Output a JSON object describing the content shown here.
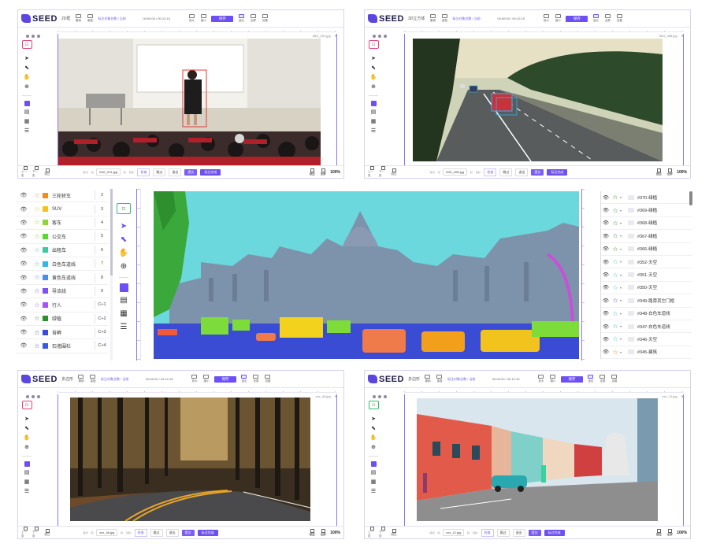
{
  "app": {
    "logo_text": "SEED",
    "win1_mode": "2D框",
    "win2_mode": "3D立方体",
    "win3_mode": "多边形",
    "win4_mode": "多边形",
    "undo": "撤销",
    "redo": "重做",
    "tb_a": "放大",
    "tb_b": "缩小",
    "tb_c": "适应",
    "tb_d": "全屏",
    "tb_e": "设置",
    "tb_f": "快捷",
    "tb_g": "选项",
    "save": "保存",
    "info_left": "标注对象总数 / 当前",
    "info_mid": "00:00:00 / 00:12:15",
    "info_right": "3/12  已标注图片数",
    "zoom": "100%",
    "prev": "上一张",
    "next": "下一张",
    "skip": "跳过",
    "submit": "提交",
    "exit": "退出",
    "check": "检查",
    "review": "审核通过",
    "quit": "标注完成",
    "file1": "IMG_001.jpg",
    "file2": "IMG_088.jpg",
    "file3": "xxx_46.jpg",
    "file4": "xxx_12.jpg"
  },
  "labels": [
    {
      "name": "三轮轿车",
      "key": "2",
      "color": "#f28c1c",
      "star": "#f28c1c"
    },
    {
      "name": "SUV",
      "key": "3",
      "color": "#f2c31c",
      "star": "#f2c31c"
    },
    {
      "name": "客车",
      "key": "4",
      "color": "#8fd43a",
      "star": "#8fd43a"
    },
    {
      "name": "公交车",
      "key": "5",
      "color": "#5fd43a",
      "star": "#5fd43a"
    },
    {
      "name": "出租车",
      "key": "6",
      "color": "#3ec8a0",
      "star": "#3ec8a0"
    },
    {
      "name": "白色车道线",
      "key": "7",
      "color": "#3ab4e0",
      "star": "#3ab4e0"
    },
    {
      "name": "黄色车道线",
      "key": "8",
      "color": "#4c8fea",
      "star": "#4c8fea"
    },
    {
      "name": "导流线",
      "key": "9",
      "color": "#7a54ef",
      "star": "#7a54ef"
    },
    {
      "name": "行人",
      "key": "C+1",
      "color": "#a854ef",
      "star": "#a854ef"
    },
    {
      "name": "绿植",
      "key": "C+2",
      "color": "#2e8f2e",
      "star": "#2e8f2e"
    },
    {
      "name": "苔藓",
      "key": "C+3",
      "color": "#3a4cd4",
      "star": "#3a4cd4"
    },
    {
      "name": "石墙围栏",
      "key": "C+4",
      "color": "#3a58e0",
      "star": "#3a58e0"
    }
  ],
  "objects": [
    {
      "name": "#370-绿植",
      "star": "#2e8f2e"
    },
    {
      "name": "#369-绿植",
      "star": "#2e8f2e"
    },
    {
      "name": "#368-绿植",
      "star": "#2e8f2e"
    },
    {
      "name": "#367-绿植",
      "star": "#2e8f2e"
    },
    {
      "name": "#366-绿植",
      "star": "#2e8f2e"
    },
    {
      "name": "#352-天空",
      "star": "#3ec8c0"
    },
    {
      "name": "#351-天空",
      "star": "#3ec8c0"
    },
    {
      "name": "#350-天空",
      "star": "#3ec8c0"
    },
    {
      "name": "#349-路旁其它门框",
      "star": "#4c5fea"
    },
    {
      "name": "#348-白色车道线",
      "star": "#3ab4e0"
    },
    {
      "name": "#347-白色车道线",
      "star": "#3ab4e0"
    },
    {
      "name": "#346-天空",
      "star": "#3ec8c0"
    },
    {
      "name": "#345-建筑",
      "star": "#f28c1c"
    }
  ],
  "colors": {
    "accent": "#6d4ff5",
    "sky_mask": "#6ad8dc",
    "road_mask": "#3a4cd4",
    "building_mask": "#7a8fb0"
  }
}
